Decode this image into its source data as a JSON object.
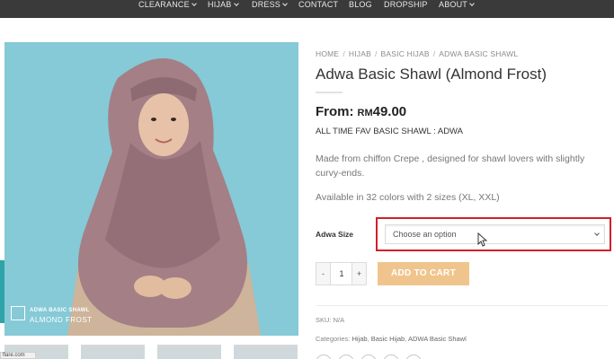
{
  "nav": {
    "items": [
      {
        "label": "CLEARANCE",
        "caret": true
      },
      {
        "label": "HIJAB",
        "caret": true
      },
      {
        "label": "DRESS",
        "caret": true
      },
      {
        "label": "CONTACT",
        "caret": false
      },
      {
        "label": "BLOG",
        "caret": false
      },
      {
        "label": "DROPSHIP",
        "caret": false
      },
      {
        "label": "ABOUT",
        "caret": true
      }
    ]
  },
  "gallery": {
    "watermark_line1": "ADWA BASIC SHAWL",
    "watermark_line2": "ALMOND FROST"
  },
  "breadcrumb": [
    "HOME",
    "HIJAB",
    "BASIC HIJAB",
    "ADWA BASIC SHAWL"
  ],
  "product": {
    "title": "Adwa Basic Shawl (Almond Frost)",
    "price_prefix": "From:",
    "currency": "RM",
    "price": "49.00",
    "tagline": "ALL TIME FAV BASIC SHAWL : ADWA",
    "description": "Made from chiffon Crepe , designed for shawl lovers with slightly curvy-ends.",
    "availability": "Available in 32 colors with 2 sizes (XL, XXL)"
  },
  "variation": {
    "label": "Adwa Size",
    "selected": "Choose an option"
  },
  "cart": {
    "minus": "-",
    "quantity": "1",
    "plus": "+",
    "add_label": "ADD TO CART"
  },
  "meta": {
    "sku_label": "SKU:",
    "sku_value": "N/A",
    "categories_label": "Categories:",
    "categories": [
      "Hijab",
      "Basic Hijab",
      "ADWA Basic Shawl"
    ]
  },
  "status_bar": {
    "url": "flare.com"
  },
  "colors": {
    "nav_bg": "#3a3a3a",
    "image_bg": "#86c9d7",
    "shawl": "#a47f86",
    "add_to_cart": "#f0c58d",
    "highlight": "#d0202a"
  }
}
